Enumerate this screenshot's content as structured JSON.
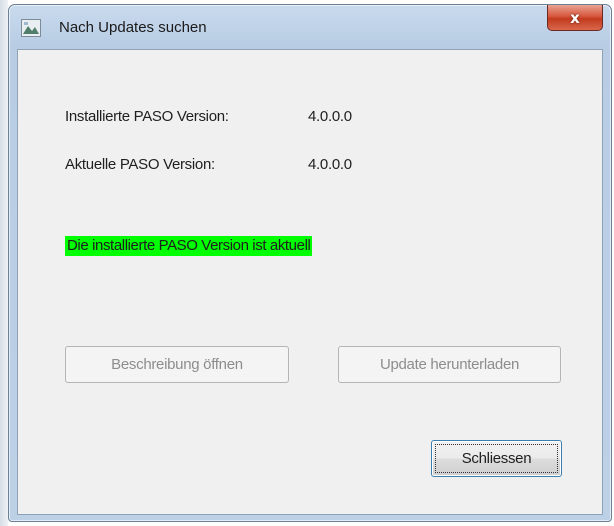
{
  "window": {
    "title": "Nach Updates suchen",
    "close_label": "x"
  },
  "info": {
    "installed_label": "Installierte PASO Version:",
    "installed_value": "4.0.0.0",
    "current_label": "Aktuelle PASO Version:",
    "current_value": "4.0.0.0"
  },
  "status": {
    "text": "Die installierte PASO Version ist aktuell",
    "color": "#00ff00"
  },
  "buttons": {
    "open_description": "Beschreibung öffnen",
    "download_update": "Update herunterladen",
    "close": "Schliessen"
  }
}
